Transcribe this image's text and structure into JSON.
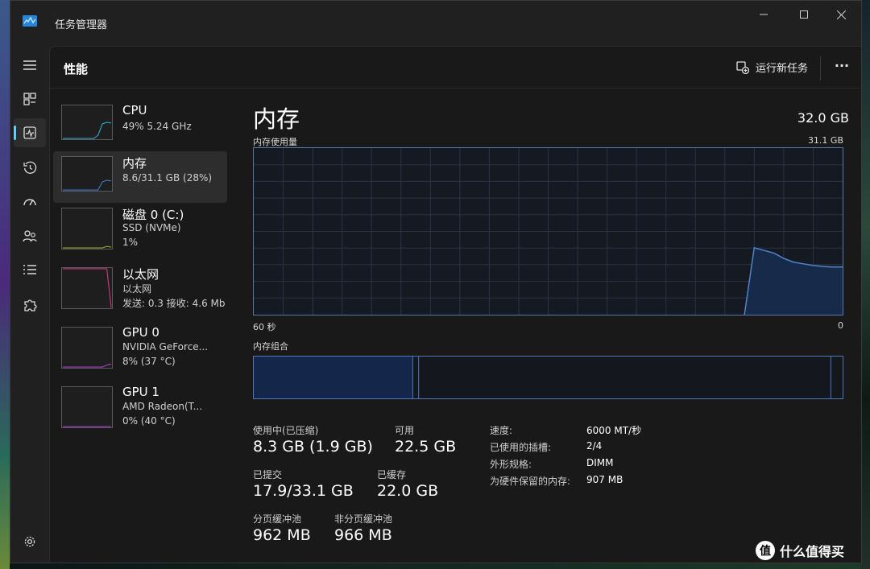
{
  "window": {
    "title": "任务管理器"
  },
  "header": {
    "page_title": "性能",
    "run_new_task": "运行新任务",
    "more": "···"
  },
  "nav": [
    {
      "icon": "hamburger-menu-icon"
    },
    {
      "icon": "processes-icon"
    },
    {
      "icon": "performance-icon",
      "active": true
    },
    {
      "icon": "app-history-icon"
    },
    {
      "icon": "startup-apps-icon"
    },
    {
      "icon": "users-icon"
    },
    {
      "icon": "details-list-icon"
    },
    {
      "icon": "services-puzzle-icon"
    },
    {
      "icon": "settings-gear-icon"
    }
  ],
  "resources": [
    {
      "name": "CPU",
      "sub1": "49%  5.24 GHz",
      "sub2": "",
      "sub3": "",
      "spark": [
        0,
        0,
        0,
        0,
        0,
        0,
        0,
        0,
        0.1,
        0.45,
        0.5,
        0.48
      ],
      "spark_color": "#2fa6c8"
    },
    {
      "name": "内存",
      "sub1": "8.6/31.1 GB (28%)",
      "sub2": "",
      "sub3": "",
      "spark": [
        0,
        0,
        0,
        0,
        0,
        0,
        0,
        0,
        0,
        0.25,
        0.3,
        0.28
      ],
      "spark_color": "#3a78c8"
    },
    {
      "name": "磁盘 0 (C:)",
      "sub1": "SSD (NVMe)",
      "sub2": "1%",
      "sub3": "",
      "spark": [
        0,
        0,
        0,
        0,
        0,
        0,
        0,
        0,
        0,
        0,
        0.04,
        0.02
      ],
      "spark_color": "#8aa82a"
    },
    {
      "name": "以太网",
      "sub1": "以太网",
      "sub2": "发送: 0.3  接收: 4.6 Mb",
      "sub3": "",
      "spark": [
        1,
        1,
        1,
        1,
        1,
        1,
        1,
        1,
        1,
        1,
        1,
        0
      ],
      "spark_color": "#c8387a"
    },
    {
      "name": "GPU 0",
      "sub1": "NVIDIA GeForce...",
      "sub2": "8% (37 °C)",
      "sub3": "",
      "spark": [
        0,
        0,
        0,
        0,
        0,
        0,
        0,
        0,
        0,
        0,
        0.05,
        0.08
      ],
      "spark_color": "#a83ac8"
    },
    {
      "name": "GPU 1",
      "sub1": "AMD Radeon(T...",
      "sub2": "0% (40 °C)",
      "sub3": "",
      "spark": [
        0,
        0,
        0,
        0,
        0,
        0,
        0,
        0,
        0,
        0,
        0,
        0
      ],
      "spark_color": "#a83ac8"
    }
  ],
  "memory": {
    "title": "内存",
    "total": "32.0 GB",
    "usage_label": "内存使用量",
    "usage_max": "31.1 GB",
    "time_left": "60 秒",
    "time_right": "0",
    "composition_label": "内存组合",
    "composition": {
      "in_use": 0.27,
      "modified": 0.01,
      "standby": 0.7,
      "free": 0.02
    },
    "stats": {
      "in_use_label": "使用中(已压缩)",
      "in_use_value": "8.3 GB (1.9 GB)",
      "available_label": "可用",
      "available_value": "22.5 GB",
      "committed_label": "已提交",
      "committed_value": "17.9/33.1 GB",
      "cached_label": "已缓存",
      "cached_value": "22.0 GB",
      "paged_label": "分页缓冲池",
      "paged_value": "962 MB",
      "nonpaged_label": "非分页缓冲池",
      "nonpaged_value": "966 MB"
    },
    "specs": [
      {
        "key": "速度:",
        "value": "6000 MT/秒"
      },
      {
        "key": "已使用的插槽:",
        "value": "2/4"
      },
      {
        "key": "外形规格:",
        "value": "DIMM"
      },
      {
        "key": "为硬件保留的内存:",
        "value": "907 MB"
      }
    ]
  },
  "chart_data": {
    "type": "area",
    "title": "内存使用量",
    "x": [
      60,
      59,
      58,
      57,
      56,
      55,
      54,
      53,
      52,
      51,
      50,
      49,
      48,
      47,
      46,
      45,
      44,
      43,
      42,
      41,
      40,
      39,
      38,
      37,
      36,
      35,
      34,
      33,
      32,
      31,
      30,
      29,
      28,
      27,
      26,
      25,
      24,
      23,
      22,
      21,
      20,
      19,
      18,
      17,
      16,
      15,
      14,
      13,
      12,
      11,
      10,
      9,
      8,
      7,
      6,
      5,
      4,
      3,
      2,
      1,
      0
    ],
    "xlim": [
      60,
      0
    ],
    "ylim": [
      0,
      31.1
    ],
    "series": [
      {
        "values": [
          null,
          null,
          null,
          null,
          null,
          null,
          null,
          null,
          null,
          null,
          null,
          null,
          null,
          null,
          null,
          null,
          null,
          null,
          null,
          null,
          null,
          null,
          null,
          null,
          null,
          null,
          null,
          null,
          null,
          null,
          null,
          null,
          null,
          null,
          null,
          null,
          null,
          null,
          null,
          null,
          null,
          null,
          null,
          null,
          null,
          null,
          null,
          null,
          null,
          null,
          0,
          12.5,
          12.0,
          11.5,
          10.5,
          9.8,
          9.5,
          9.2,
          9.0,
          8.9,
          8.9
        ]
      }
    ],
    "grid": true
  },
  "watermark": {
    "badge": "值",
    "text": "什么值得买"
  }
}
